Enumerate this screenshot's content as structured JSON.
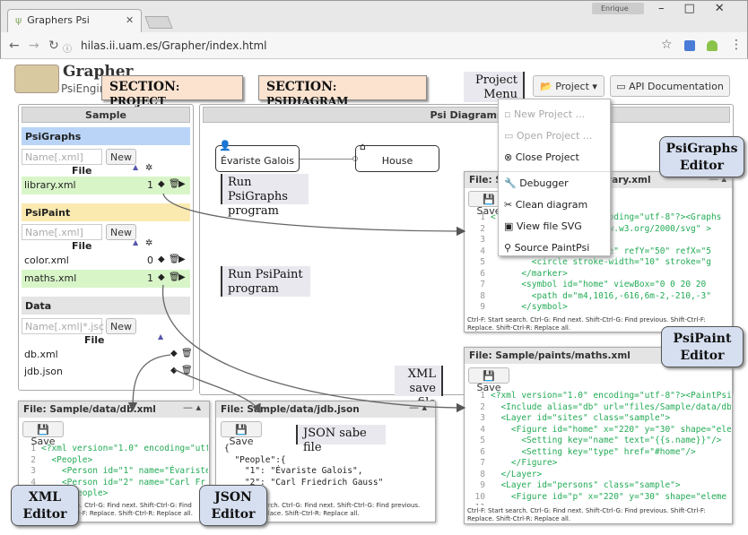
{
  "browser": {
    "tab_title": "Graphers Psi",
    "tab_close": "✕",
    "user": "Enrique",
    "url": "hilas.ii.uam.es/Grapher/index.html",
    "win_buttons": "–□✕"
  },
  "app": {
    "name": "Grapher",
    "subtitle": "PsiEngine"
  },
  "callouts": {
    "section_project_a": "SECTION",
    "section_project_b": ": PROJECT",
    "section_diagram_a": "SECTION",
    "section_diagram_b": ": PSIDIAGRAM",
    "project_menu": "Project\nMenu",
    "run_psigraphs": "Run PsiGraphs\nprogram",
    "run_psipaint": "Run PsiPaint\nprogram",
    "xml_save": "XML\nsave file",
    "json_save": "JSON sabe file",
    "psigraphs_editor": "PsiGraphs\nEditor",
    "psipaint_editor": "PsiPaint\nEditor",
    "xml_editor": "XML\nEditor",
    "json_editor": "JSON\nEditor"
  },
  "toolbar": {
    "project_label": "Project",
    "api_label": "API Documentation"
  },
  "project_menu": {
    "items": [
      "New Project ...",
      "Open Project ...",
      "Close Project",
      "Debugger",
      "Clean diagram",
      "View file SVG",
      "Source PaintPsi"
    ]
  },
  "sample": {
    "title": "Sample",
    "psigraphs": {
      "title": "PsiGraphs",
      "placeholder": "Name[.xml]",
      "new": "New",
      "col": "File",
      "files": [
        {
          "name": "library.xml",
          "count": "1"
        }
      ]
    },
    "psipaint": {
      "title": "PsiPaint",
      "placeholder": "Name[.xml]",
      "new": "New",
      "col": "File",
      "files": [
        {
          "name": "color.xml",
          "count": "0"
        },
        {
          "name": "maths.xml",
          "count": "1"
        }
      ]
    },
    "data": {
      "title": "Data",
      "placeholder": "Name[.xml|*.jsc",
      "new": "New",
      "col": "File",
      "files": [
        {
          "name": "db.xml"
        },
        {
          "name": "jdb.json"
        }
      ]
    }
  },
  "diagram": {
    "title": "Psi Diagrams",
    "node1": "Évariste Galois",
    "node2": "House"
  },
  "editors": {
    "psigraphs": {
      "title": "File: Sample/psigraphs/library.xml",
      "save": "Save",
      "lines": [
        "1",
        "2",
        "3",
        "4",
        "5",
        "6",
        "7",
        "8",
        "9",
        "10"
      ],
      "code": "<?xml version=\"1.0\" encoding=\"utf-8\"?><Graphs\n  <svg xmlns=\"http://www.w3.org/2000/svg\" >\n    <defs>\n      <marker id=\"circle\" refY=\"50\" refX=\"5\n        <circle stroke-width=\"10\" stroke=\"g\n      </marker>\n      <symbol id=\"home\" viewBox=\"0 0 20 20\n        <path d=\"m4,1016,-616,6m-2,-210,-3\"\n      </symbol>\n"
    },
    "maths": {
      "title": "File: Sample/paints/maths.xml",
      "save": "Save",
      "lines": [
        "1",
        "2",
        "3",
        "4",
        "5",
        "6",
        "7",
        "8",
        "9",
        "10",
        "11"
      ],
      "code": "<?xml version=\"1.0\" encoding=\"utf-8\"?><PaintPsi\n  <Include alias=\"db\" url=\"files/Sample/data/db\n  <Layer id=\"sites\" class=\"sample\">\n    <Figure id=\"home\" x=\"220\" y=\"30\" shape=\"ele\n      <Setting key=\"name\" text=\"{{s.name}}\"/>\n      <Setting key=\"type\" href=\"#home\"/>\n    </Figure>\n  </Layer>\n  <Layer id=\"persons\" class=\"sample\">\n    <Figure id=\"p\" x=\"220\" y=\"30\" shape=\"eleme\n"
    },
    "db": {
      "title": "File: Sample/data/db.xml",
      "save": "Save",
      "lines": [
        "1",
        "2",
        "3",
        "4",
        "5"
      ],
      "code": "<?xml version=\"1.0\" encoding=\"utf\n  <People>\n    <Person id=\"1\" name=\"Évariste\n    <Person id=\"2\" name=\"Carl Fr\n    </People>\n"
    },
    "jdb": {
      "title": "File: Sample/data/jdb.json",
      "save": "Save",
      "code": "{\n  \"People\":{\n    \"1\": \"Évariste Galois\",\n    \"2\": \"Carl Friedrich Gauss\"\n  },\n"
    },
    "hint1": "Ctrl-F: Start search. Ctrl-G: Find next. Shift-Ctrl-G: Find previous. Shift-Ctrl-F:",
    "hint2": "Replace. Shift-Ctrl-R: Replace all."
  }
}
